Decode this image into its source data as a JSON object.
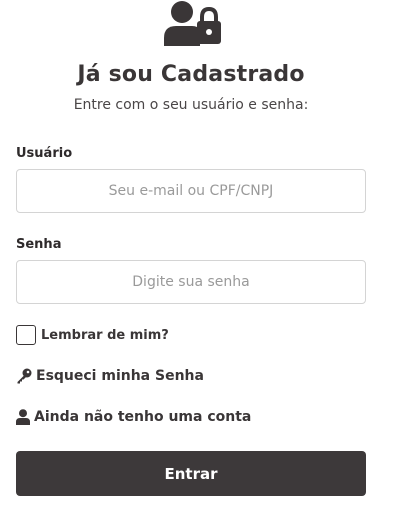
{
  "header": {
    "icon": "user-lock-icon",
    "title": "Já sou Cadastrado",
    "subtitle": "Entre com o seu usuário e senha:"
  },
  "form": {
    "username": {
      "label": "Usuário",
      "placeholder": "Seu e-mail ou CPF/CNPJ",
      "value": ""
    },
    "password": {
      "label": "Senha",
      "placeholder": "Digite sua senha",
      "value": ""
    },
    "remember_me": {
      "label": "Lembrar de mim?",
      "checked": false
    }
  },
  "links": {
    "forgot_password": {
      "label": "Esqueci minha Senha",
      "icon": "key-icon"
    },
    "no_account": {
      "label": "Ainda não tenho uma conta",
      "icon": "user-icon"
    }
  },
  "actions": {
    "submit_label": "Entrar"
  },
  "colors": {
    "primary": "#3d393a",
    "text": "#3a3637",
    "border": "#d4d4d4"
  }
}
